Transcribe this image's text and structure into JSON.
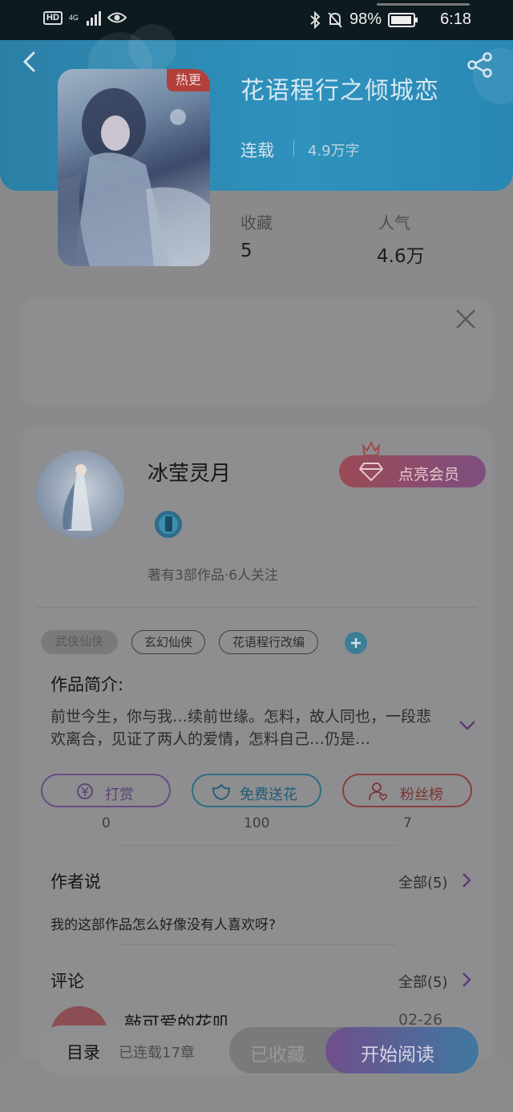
{
  "status_bar": {
    "hd": "HD",
    "network": "4G",
    "battery": "98%",
    "time": "6:18",
    "battery_level": 0.98
  },
  "book": {
    "title": "花语程行之倾城恋",
    "hot_tag": "热更",
    "status": "连载",
    "words": "4.9万字",
    "stats": {
      "collect_label": "收藏",
      "collect_value": "5",
      "popularity_label": "人气",
      "popularity_value": "4.6万"
    }
  },
  "author": {
    "name": "冰莹灵月",
    "meta": "著有3部作品·6人关注",
    "vip_button": "点亮会员"
  },
  "tags": [
    "武侠仙侠",
    "玄幻仙侠",
    "花语程行改编"
  ],
  "intro": {
    "heading": "作品简介:",
    "text": "前世今生，你与我…续前世缘。怎料，故人同也，一段悲欢离合，见证了两人的爱情，怎料自己…仍是…"
  },
  "actions": [
    {
      "label": "打赏",
      "count": "0"
    },
    {
      "label": "免费送花",
      "count": "100"
    },
    {
      "label": "粉丝榜",
      "count": "7"
    }
  ],
  "author_says": {
    "heading": "作者说",
    "more": "全部(5)",
    "text": "我的这部作品怎么好像没有人喜欢呀?"
  },
  "comments": {
    "heading": "评论",
    "more": "全部(5)",
    "first": {
      "name": "敲可爱的花叽",
      "date": "02-26"
    }
  },
  "bottom_bar": {
    "toc": "目录",
    "chapters": "已连载17章",
    "collected": "已收藏",
    "read": "开始阅读"
  },
  "colors": {
    "header_blue": "#2e92bd",
    "vip": "#9a4a56",
    "read_start": "#6f4f8c",
    "read_end": "#3f78a0"
  }
}
